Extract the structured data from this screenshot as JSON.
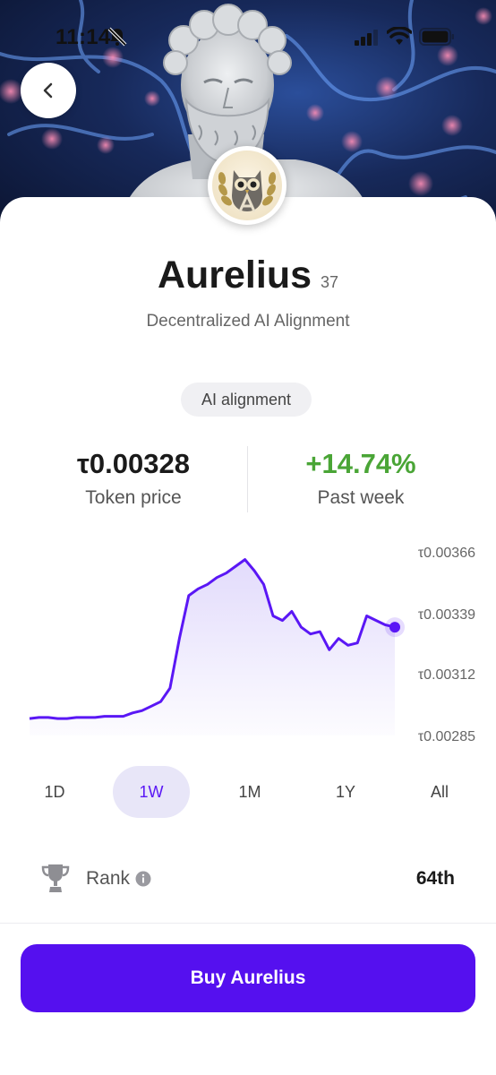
{
  "status_bar": {
    "time": "11:14",
    "icons": [
      "bell-slash-icon",
      "signal-icon",
      "wifi-icon",
      "battery-icon"
    ]
  },
  "nav": {
    "back_icon": "chevron-left-icon"
  },
  "subnet": {
    "name": "Aurelius",
    "number": "37",
    "description": "Decentralized AI Alignment",
    "tag": "AI alignment"
  },
  "stats": {
    "price": "τ0.00328",
    "price_label": "Token price",
    "change": "+14.74%",
    "change_label": "Past week"
  },
  "colors": {
    "accent": "#5510ef",
    "positive": "#4aa536",
    "line": "#5a17f5",
    "active_range_bg": "#e8e6f8"
  },
  "chart_data": {
    "type": "area",
    "y_tick_labels": [
      "τ0.00366",
      "τ0.00339",
      "τ0.00312",
      "τ0.00285"
    ],
    "ylim": [
      0.00285,
      0.00366
    ],
    "series": [
      {
        "values": [
          0.002925,
          0.00293,
          0.00293,
          0.002925,
          0.002925,
          0.00293,
          0.00293,
          0.00293,
          0.002935,
          0.002935,
          0.002935,
          0.00295,
          0.00296,
          0.00298,
          0.003,
          0.00306,
          0.00328,
          0.00347,
          0.0035,
          0.00352,
          0.00355,
          0.00357,
          0.0036,
          0.00363,
          0.00358,
          0.00352,
          0.00338,
          0.00336,
          0.0034,
          0.00333,
          0.0033,
          0.00331,
          0.00323,
          0.00328,
          0.00325,
          0.00326,
          0.00338,
          0.00336,
          0.00334,
          0.00333
        ]
      }
    ]
  },
  "ranges": [
    "1D",
    "1W",
    "1M",
    "1Y",
    "All"
  ],
  "active_range": "1W",
  "rank": {
    "label": "Rank",
    "value": "64th"
  },
  "buy_button": {
    "label": "Buy Aurelius"
  }
}
